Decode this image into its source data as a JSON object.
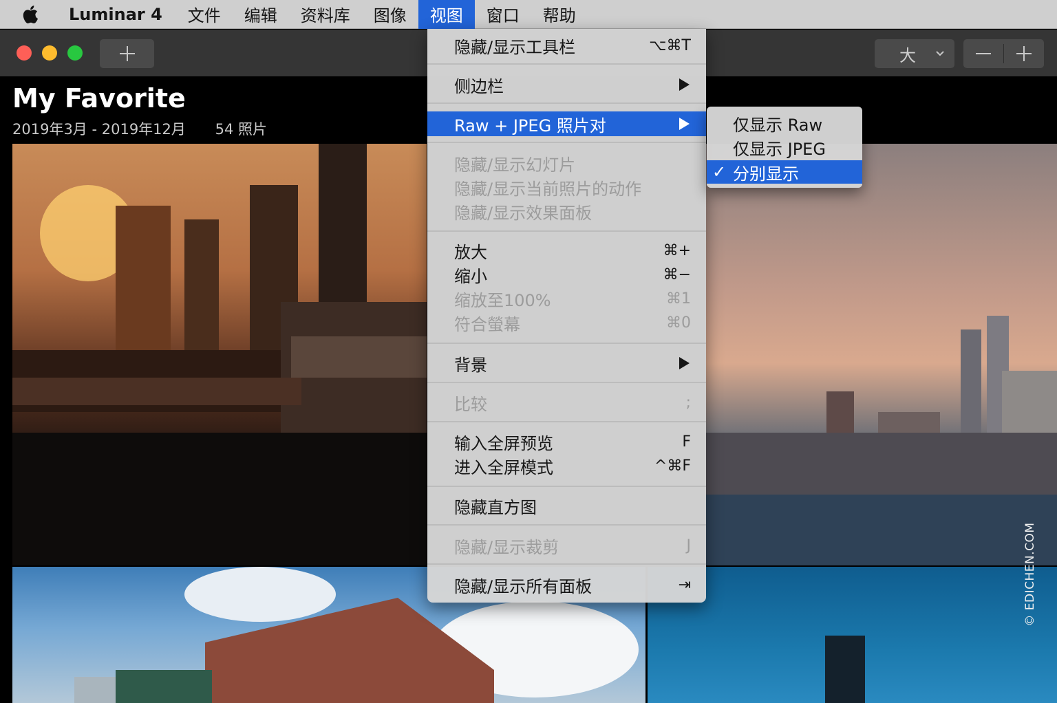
{
  "menubar": {
    "app_name": "Luminar 4",
    "items": [
      "文件",
      "编辑",
      "资料库",
      "图像",
      "视图",
      "窗口",
      "帮助"
    ],
    "active_item": "视图",
    "apple_icon": "apple-icon"
  },
  "toolbar": {
    "add_icon": "plus-icon",
    "size_label": "大",
    "size_chevron_icon": "chevron-down-icon",
    "zoom_out_icon": "minus-icon",
    "zoom_in_icon": "plus-icon"
  },
  "album": {
    "title": "My Favorite",
    "date_range": "2019年3月 - 2019年12月",
    "count": "54 照片"
  },
  "view_menu": {
    "toolbar_toggle": {
      "label": "隐藏/显示工具栏",
      "shortcut": "⌥⌘T"
    },
    "sidebar": {
      "label": "侧边栏"
    },
    "raw_jpeg": {
      "label": "Raw + JPEG 照片对"
    },
    "slideshow": {
      "label": "隐藏/显示幻灯片"
    },
    "actions": {
      "label": "隐藏/显示当前照片的动作"
    },
    "effects": {
      "label": "隐藏/显示效果面板"
    },
    "zoom_in": {
      "label": "放大",
      "shortcut": "⌘+"
    },
    "zoom_out": {
      "label": "缩小",
      "shortcut": "⌘−"
    },
    "zoom_100": {
      "label": "缩放至100%",
      "shortcut": "⌘1"
    },
    "fit_screen": {
      "label": "符合螢幕",
      "shortcut": "⌘0"
    },
    "background": {
      "label": "背景"
    },
    "compare": {
      "label": "比较",
      "shortcut": ";"
    },
    "fullscreen_preview": {
      "label": "输入全屏预览",
      "shortcut": "F"
    },
    "fullscreen_mode": {
      "label": "进入全屏模式",
      "shortcut": "^⌘F"
    },
    "histogram": {
      "label": "隐藏直方图"
    },
    "crop": {
      "label": "隐藏/显示裁剪",
      "shortcut": "J"
    },
    "all_panels": {
      "label": "隐藏/显示所有面板",
      "shortcut": "⇥"
    }
  },
  "submenu": {
    "raw_only": "仅显示 Raw",
    "jpeg_only": "仅显示 JPEG",
    "separate": "分别显示",
    "checkmark": "✓"
  },
  "watermark": "© EDICHEN.COM",
  "colors": {
    "highlight": "#2264d8",
    "menubar": "#cfcfcf",
    "toolbar": "#353535",
    "close": "#fe5f57",
    "minimize": "#febc2e",
    "maximize": "#28c840"
  }
}
